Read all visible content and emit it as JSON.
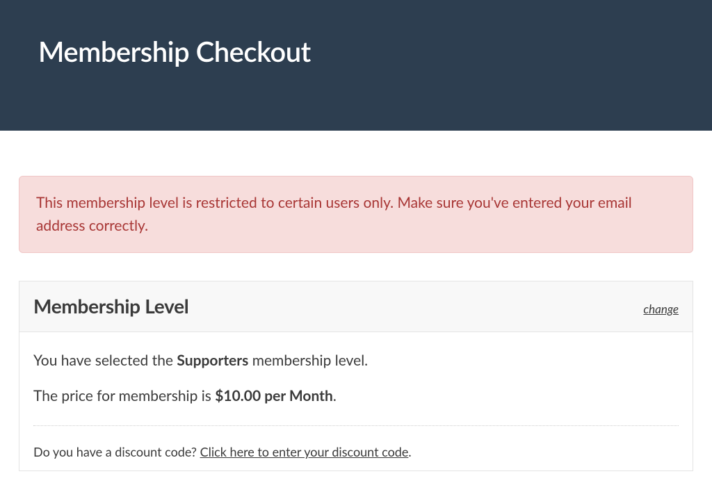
{
  "header": {
    "title": "Membership Checkout"
  },
  "alert": {
    "message": "This membership level is restricted to certain users only. Make sure you've entered your email address correctly."
  },
  "membership": {
    "section_title": "Membership Level",
    "change_label": "change",
    "selected_prefix": "You have selected the ",
    "selected_level": "Supporters",
    "selected_suffix": " membership level.",
    "price_prefix": "The price for membership is ",
    "price_value": "$10.00 per Month",
    "price_suffix": ".",
    "discount_prompt": "Do you have a discount code? ",
    "discount_link": "Click here to enter your discount code",
    "discount_suffix": "."
  }
}
